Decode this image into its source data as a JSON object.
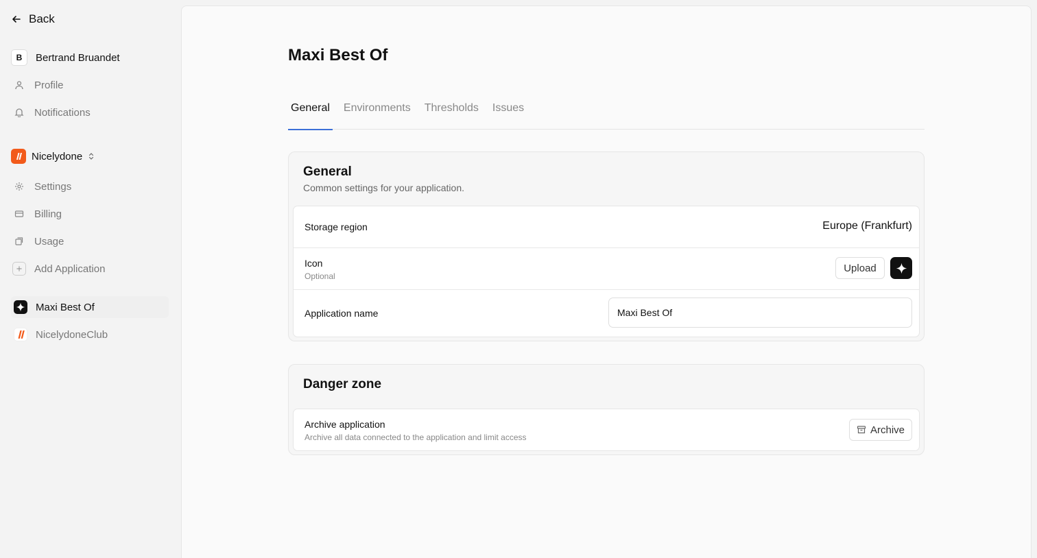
{
  "sidebar": {
    "back_label": "Back",
    "user": {
      "initial": "B",
      "name": "Bertrand Bruandet"
    },
    "account_items": [
      {
        "label": "Profile",
        "icon": "user-icon"
      },
      {
        "label": "Notifications",
        "icon": "bell-icon"
      }
    ],
    "org": {
      "name": "Nicelydone",
      "brand_color": "#f25a1a"
    },
    "org_items": [
      {
        "label": "Settings",
        "icon": "gear-icon"
      },
      {
        "label": "Billing",
        "icon": "card-icon"
      },
      {
        "label": "Usage",
        "icon": "usage-icon"
      },
      {
        "label": "Add Application",
        "icon": "plus-icon"
      }
    ],
    "apps": [
      {
        "label": "Maxi Best Of",
        "icon": "sparkle-icon",
        "active": true
      },
      {
        "label": "NicelydoneClub",
        "icon": "nicelydone-logo-icon",
        "active": false
      }
    ]
  },
  "main": {
    "title": "Maxi Best Of",
    "tabs": [
      {
        "label": "General",
        "active": true
      },
      {
        "label": "Environments",
        "active": false
      },
      {
        "label": "Thresholds",
        "active": false
      },
      {
        "label": "Issues",
        "active": false
      }
    ],
    "accent_color": "#3b6fd8",
    "general": {
      "title": "General",
      "subtitle": "Common settings for your application.",
      "storage_region_label": "Storage region",
      "storage_region_value": "Europe (Frankfurt)",
      "icon_label": "Icon",
      "icon_hint": "Optional",
      "upload_label": "Upload",
      "app_name_label": "Application name",
      "app_name_value": "Maxi Best Of"
    },
    "danger": {
      "title": "Danger zone",
      "archive_label": "Archive application",
      "archive_hint": "Archive all data connected to the application and limit access",
      "archive_button": "Archive"
    }
  }
}
